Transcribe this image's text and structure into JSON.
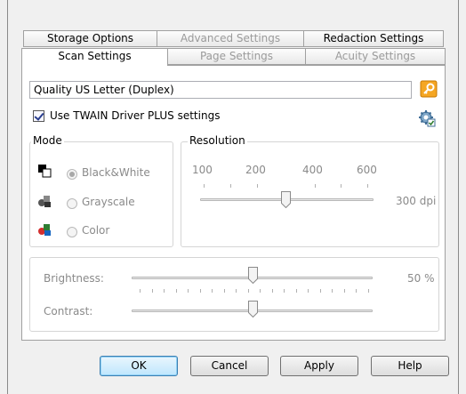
{
  "tabs": {
    "row1": [
      {
        "label": "Storage Options",
        "disabled": false
      },
      {
        "label": "Advanced Settings",
        "disabled": true
      },
      {
        "label": "Redaction Settings",
        "disabled": false
      }
    ],
    "row2": [
      {
        "label": "Scan Settings",
        "active": true
      },
      {
        "label": "Page Settings",
        "disabled": true
      },
      {
        "label": "Acuity Settings",
        "disabled": true
      }
    ]
  },
  "profile": {
    "name": "Quality US Letter (Duplex)",
    "lock_icon": "lock-icon"
  },
  "twain": {
    "checkbox_label": "Use TWAIN Driver PLUS settings",
    "checked": true,
    "settings_icon": "gear-settings-icon"
  },
  "mode": {
    "title": "Mode",
    "options": [
      {
        "label": "Black&White",
        "selected": true,
        "icon": "black-white-icon"
      },
      {
        "label": "Grayscale",
        "selected": false,
        "icon": "grayscale-icon"
      },
      {
        "label": "Color",
        "selected": false,
        "icon": "color-icon"
      }
    ]
  },
  "resolution": {
    "title": "Resolution",
    "scale_labels": [
      "100",
      "200",
      "400",
      "600"
    ],
    "value": 300,
    "value_label": "300 dpi"
  },
  "adjustments": {
    "brightness_label": "Brightness:",
    "brightness_value": "50 %",
    "brightness_level": 0.5,
    "contrast_label": "Contrast:",
    "contrast_level": 0.5
  },
  "buttons": {
    "ok": "OK",
    "cancel": "Cancel",
    "apply": "Apply",
    "help": "Help"
  },
  "colors": {
    "accent": "#3c7fb1",
    "disabled_text": "#8a8a8a"
  }
}
